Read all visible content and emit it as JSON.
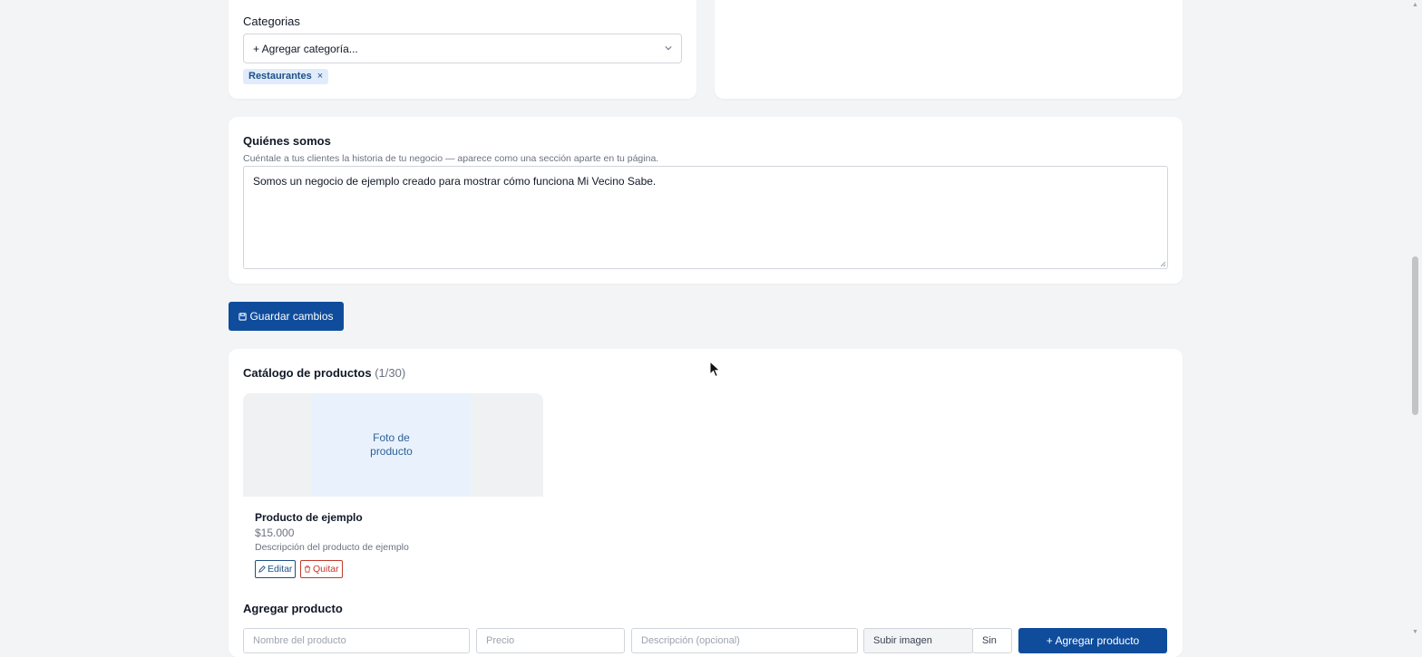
{
  "categories": {
    "label": "Categorias",
    "select_value": "+ Agregar categoría...",
    "chips": [
      "Restaurantes"
    ],
    "remove_glyph": "×"
  },
  "about": {
    "title": "Quiénes somos",
    "hint": "Cuéntale a tus clientes la historia de tu negocio — aparece como una sección aparte en tu página.",
    "text": "Somos un negocio de ejemplo creado para mostrar cómo funciona Mi Vecino Sabe."
  },
  "save_button": {
    "label": "Guardar cambios",
    "icon": "save-icon"
  },
  "catalog": {
    "title": "Catálogo de productos",
    "count": "(1/30)",
    "products": [
      {
        "photo_placeholder": "Foto de\nproducto",
        "name": "Producto de ejemplo",
        "price": "$15.000",
        "description": "Descripción del producto de ejemplo",
        "edit_label": "Editar",
        "delete_label": "Quitar"
      }
    ]
  },
  "add_product": {
    "title": "Agregar producto",
    "fields": {
      "name_placeholder": "Nombre del producto",
      "price_placeholder": "Precio",
      "description_placeholder": "Descripción (opcional)",
      "photo_button": "Subir imagen",
      "photo_extra": "Sin",
      "submit_label": "+ Agregar producto"
    }
  },
  "colors": {
    "primary": "#0f4c9c",
    "chip_bg": "#e0ecfb",
    "danger": "#c0392b"
  }
}
